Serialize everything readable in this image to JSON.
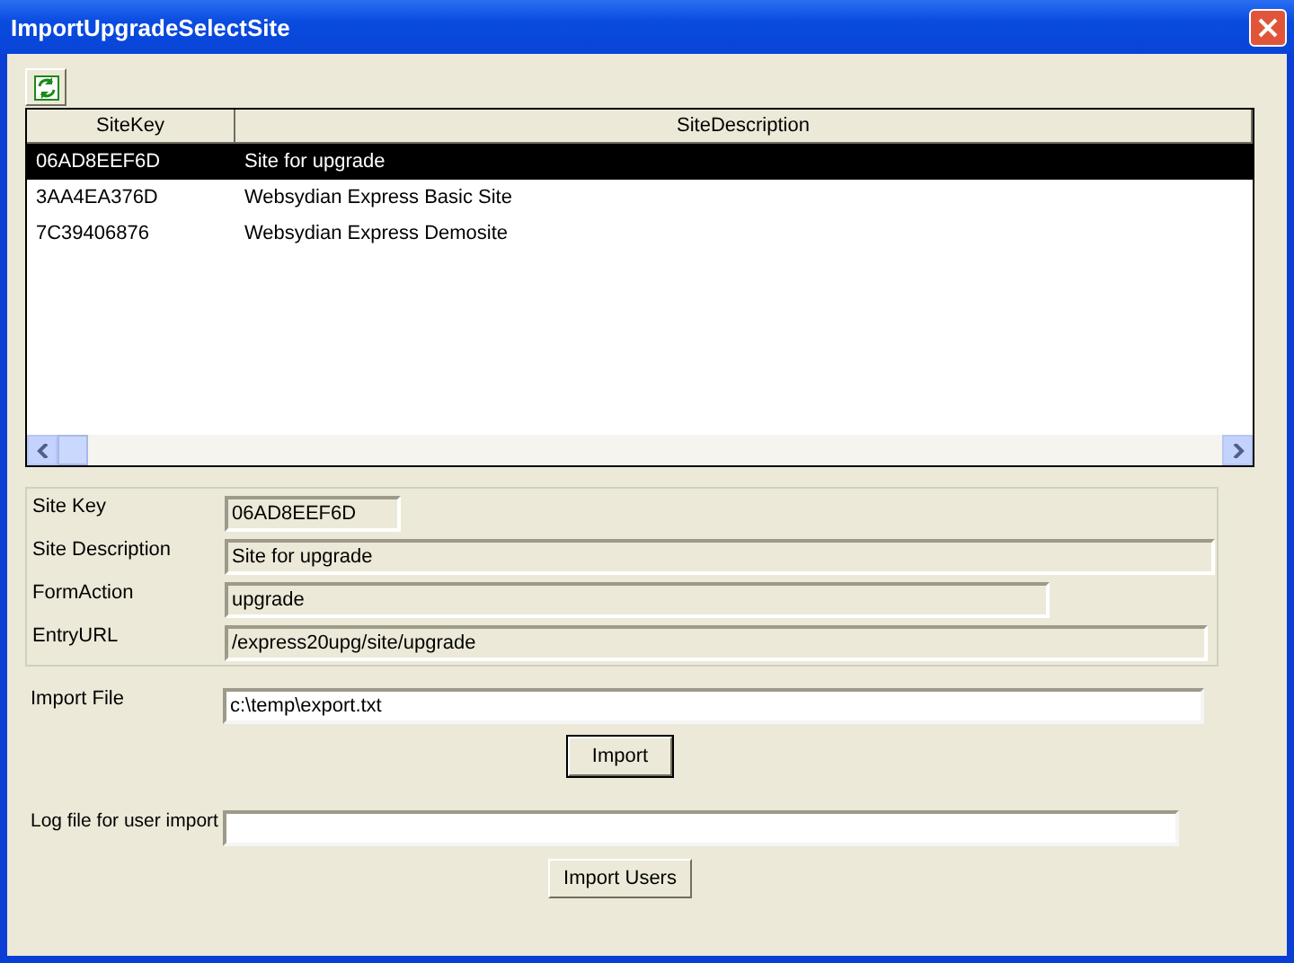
{
  "window": {
    "title": "ImportUpgradeSelectSite"
  },
  "table": {
    "columns": [
      "SiteKey",
      "SiteDescription"
    ],
    "rows": [
      {
        "cells": [
          "06AD8EEF6D",
          "Site for upgrade"
        ],
        "selected": true
      },
      {
        "cells": [
          "3AA4EA376D",
          "Websydian Express Basic Site"
        ],
        "selected": false
      },
      {
        "cells": [
          "7C39406876",
          "Websydian Express Demosite"
        ],
        "selected": false
      }
    ]
  },
  "details": [
    {
      "label": "Site Key",
      "value": "06AD8EEF6D"
    },
    {
      "label": "Site Description",
      "value": "Site for upgrade"
    },
    {
      "label": "FormAction",
      "value": "upgrade"
    },
    {
      "label": "EntryURL",
      "value": "/express20upg/site/upgrade"
    }
  ],
  "import_file": {
    "label": "Import File",
    "value": "c:\\temp\\export.txt"
  },
  "import_button": "Import",
  "log_file": {
    "label": "Log file for user import"
  },
  "import_users_button": "Import Users"
}
